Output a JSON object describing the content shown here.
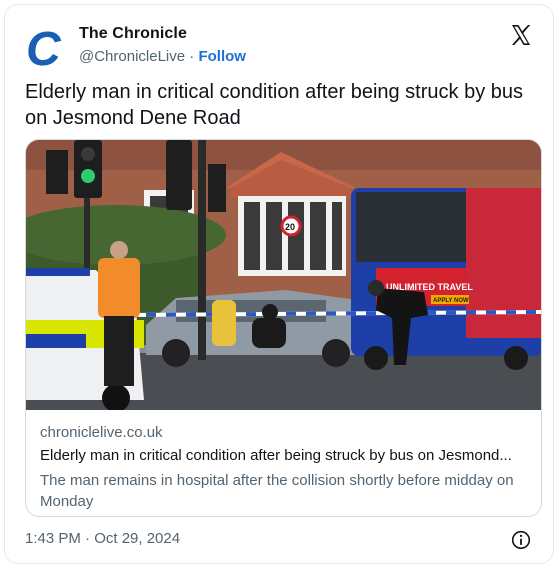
{
  "author": {
    "name": "The Chronicle",
    "handle": "@ChronicleLive",
    "separator": " · ",
    "follow_label": "Follow",
    "logo_letter": "C",
    "logo_color": "#1a5fb4"
  },
  "tweet": {
    "text": "Elderly man in critical condition after being struck by bus on Jesmond Dene Road"
  },
  "link_card": {
    "domain": "chroniclelive.co.uk",
    "title": "Elderly man in critical condition after being struck by bus on Jesmond...",
    "description": "The man remains in hospital after the collision shortly before midday on Monday",
    "image": {
      "bus_ad_text": "UNLIMITED TRAVEL",
      "bus_ad_button": "APPLY NOW",
      "speed_sign": "20",
      "accent_colors": {
        "bus_blue": "#1e3fa8",
        "bus_red": "#d2222d",
        "police_yellow": "#d8e600"
      }
    }
  },
  "footer": {
    "timestamp": "1:43 PM · Oct 29, 2024"
  },
  "colors": {
    "text": "#0f1419",
    "secondary": "#536471",
    "follow": "#1d6fd3"
  }
}
